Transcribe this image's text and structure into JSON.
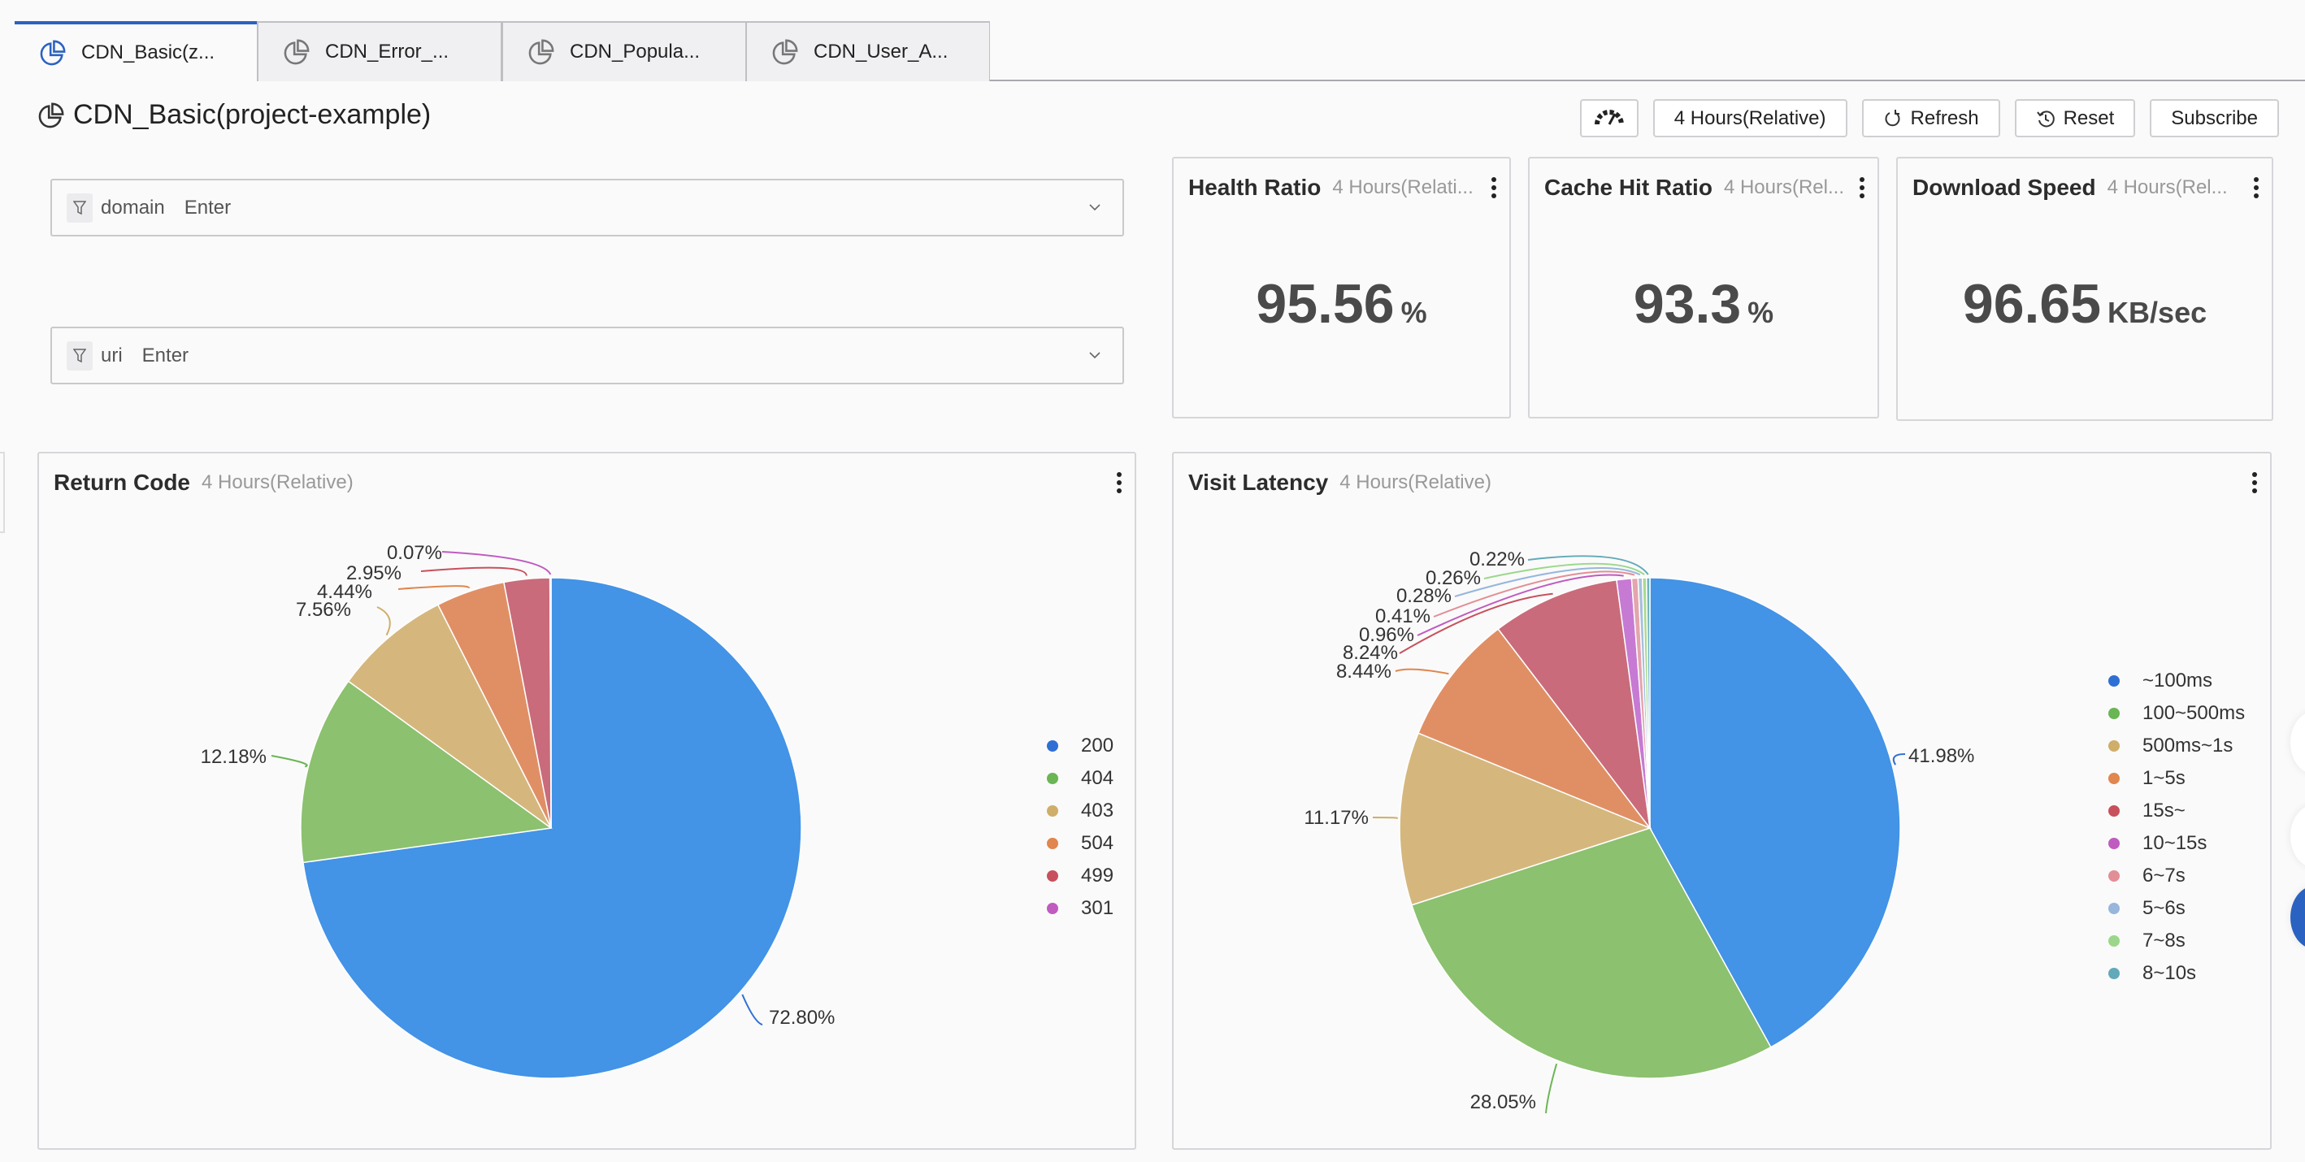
{
  "tabs": [
    {
      "label": "CDN_Basic(z...",
      "active": true
    },
    {
      "label": "CDN_Error_...",
      "active": false
    },
    {
      "label": "CDN_Popula...",
      "active": false
    },
    {
      "label": "CDN_User_A...",
      "active": false
    }
  ],
  "page": {
    "title": "CDN_Basic(project-example)"
  },
  "toolbar": {
    "time_range": "4 Hours(Relative)",
    "refresh": "Refresh",
    "reset": "Reset",
    "subscribe": "Subscribe"
  },
  "filters": [
    {
      "name": "domain",
      "placeholder": "Enter"
    },
    {
      "name": "uri",
      "placeholder": "Enter"
    }
  ],
  "stats": [
    {
      "title": "Health Ratio",
      "subtitle": "4 Hours(Relati...",
      "value": "95.56",
      "unit": "%"
    },
    {
      "title": "Cache Hit Ratio",
      "subtitle": "4 Hours(Rel...",
      "value": "93.3",
      "unit": "%"
    },
    {
      "title": "Download Speed",
      "subtitle": "4 Hours(Rel...",
      "value": "96.65",
      "unit": "KB/sec"
    }
  ],
  "panels": {
    "return_code": {
      "title": "Return Code",
      "subtitle": "4 Hours(Relative)"
    },
    "visit_latency": {
      "title": "Visit Latency",
      "subtitle": "4 Hours(Relative)"
    }
  },
  "chart_data": [
    {
      "type": "pie",
      "title": "Return Code",
      "subtitle": "4 Hours(Relative)",
      "legend": "right",
      "categories": [
        "200",
        "404",
        "403",
        "504",
        "499",
        "301"
      ],
      "values": [
        72.8,
        12.18,
        7.56,
        4.44,
        2.95,
        0.07
      ],
      "labels": [
        "72.80%",
        "12.18%",
        "7.56%",
        "4.44%",
        "2.95%",
        "0.07%"
      ],
      "colors": [
        "#4393e6",
        "#8cc16f",
        "#d5b77e",
        "#e08f65",
        "#c96b7b",
        "#c45ec3"
      ],
      "legend_colors": [
        "#2f6fd4",
        "#6ab554",
        "#cfae6a",
        "#e0864e",
        "#c8505c",
        "#c05bc0"
      ]
    },
    {
      "type": "pie",
      "title": "Visit Latency",
      "subtitle": "4 Hours(Relative)",
      "legend": "right",
      "categories": [
        "~100ms",
        "100~500ms",
        "500ms~1s",
        "1~5s",
        "15s~",
        "10~15s",
        "6~7s",
        "5~6s",
        "7~8s",
        "8~10s"
      ],
      "values": [
        41.98,
        28.05,
        11.17,
        8.44,
        8.24,
        0.96,
        0.41,
        0.28,
        0.26,
        0.22
      ],
      "labels": [
        "41.98%",
        "28.05%",
        "11.17%",
        "8.44%",
        "8.24%",
        "0.96%",
        "0.41%",
        "0.28%",
        "0.26%",
        "0.22%"
      ],
      "colors": [
        "#4393e6",
        "#8cc16f",
        "#d5b77e",
        "#e08f65",
        "#c96b7b",
        "#c67ad3",
        "#e3a5ae",
        "#a7c0dd",
        "#a9d98e",
        "#6fb3c0"
      ],
      "legend_colors": [
        "#2f6fd4",
        "#6ab554",
        "#cfae6a",
        "#e0864e",
        "#c8505c",
        "#c05bc0",
        "#e28e96",
        "#97b6dc",
        "#9bd78a",
        "#62a9b9"
      ]
    }
  ]
}
